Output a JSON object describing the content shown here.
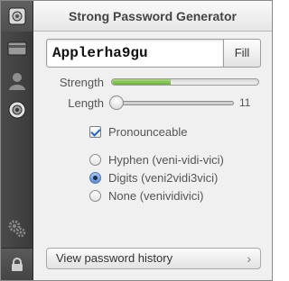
{
  "window": {
    "title": "Strong Password Generator"
  },
  "sidebar": {
    "items": [
      {
        "icon": "safe-icon"
      },
      {
        "icon": "card-icon"
      },
      {
        "icon": "person-icon"
      },
      {
        "icon": "vault-dial-icon"
      },
      {
        "icon": "gears-icon"
      },
      {
        "icon": "lock-icon"
      }
    ]
  },
  "generator": {
    "password": "Applerha9gu",
    "fill_label": "Fill",
    "strength_label": "Strength",
    "strength_fraction": 0.4,
    "length_label": "Length",
    "length_value": "11",
    "pronounceable_label": "Pronounceable",
    "pronounceable_checked": true,
    "separator_options": [
      {
        "label": "Hyphen (veni-vidi-vici)",
        "selected": false
      },
      {
        "label": "Digits (veni2vidi3vici)",
        "selected": true
      },
      {
        "label": "None (venividivici)",
        "selected": false
      }
    ],
    "history_label": "View password history"
  },
  "colors": {
    "strength_fill": "#6cb33a",
    "accent_blue": "#2468c8",
    "sidebar_bg": "#3b3b3b"
  }
}
